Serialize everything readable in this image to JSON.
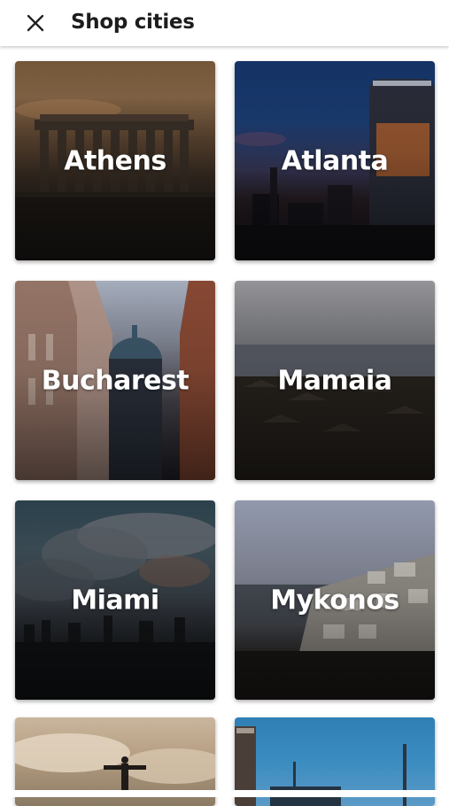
{
  "header": {
    "title": "Shop cities",
    "close_icon": "close-icon"
  },
  "cities": [
    {
      "label": "Athens"
    },
    {
      "label": "Atlanta"
    },
    {
      "label": "Bucharest"
    },
    {
      "label": "Mamaia"
    },
    {
      "label": "Miami"
    },
    {
      "label": "Mykonos"
    },
    {
      "label": ""
    },
    {
      "label": ""
    }
  ]
}
